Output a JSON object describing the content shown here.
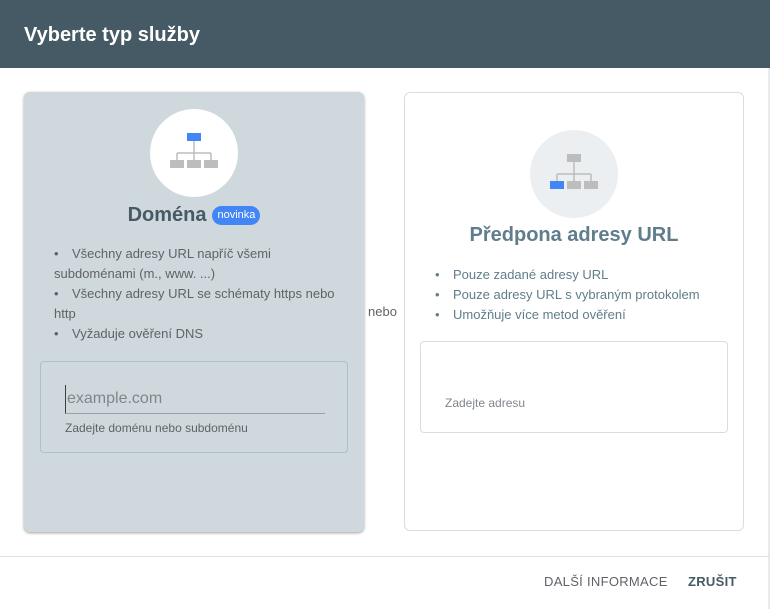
{
  "dialog": {
    "title": "Vyberte typ služby"
  },
  "domain_option": {
    "title": "Doména",
    "badge": "novinka",
    "icon": "sitemap-icon",
    "features": [
      "Všechny adresy URL napříč všemi subdoménami (m., www. ...)",
      "Všechny adresy URL se schématy https nebo http",
      "Vyžaduje ověření DNS"
    ],
    "input": {
      "value": "",
      "placeholder": "example.com",
      "hint": "Zadejte doménu nebo subdoménu"
    },
    "selected": true
  },
  "separator": {
    "label": "nebo"
  },
  "url_prefix_option": {
    "title": "Předpona adresy URL",
    "icon": "sitemap-icon",
    "features": [
      "Pouze zadané adresy URL",
      "Pouze adresy URL s vybraným protokolem",
      "Umožňuje více metod ověření"
    ],
    "input": {
      "value": "",
      "placeholder": "Zadejte adresu"
    },
    "selected": false
  },
  "footer": {
    "more_info_label": "DALŠÍ INFORMACE",
    "cancel_label": "ZRUŠIT"
  },
  "colors": {
    "header": "#455a64",
    "selected_card": "#cfd8dc",
    "accent": "#4285f4",
    "icon_gray": "#bdbdbd"
  }
}
